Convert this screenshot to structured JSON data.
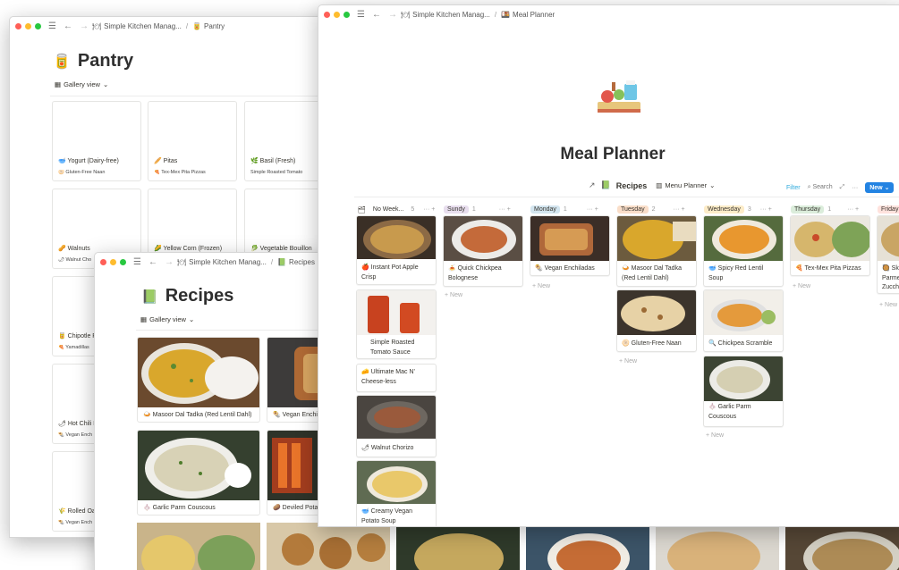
{
  "pantry_window": {
    "breadcrumb": [
      "Simple Kitchen Manag...",
      "Pantry"
    ],
    "title": "Pantry",
    "view": "Gallery view",
    "cards": [
      {
        "name": "Yogurt (Dairy-free)",
        "ref": "Gluten-Free Naan"
      },
      {
        "name": "Pitas",
        "ref": "Tex-Mex Pita Pizzas"
      },
      {
        "name": "Basil (Fresh)",
        "ref": "Simple Roasted Tomato"
      },
      {
        "name": "Walnuts",
        "ref": "Walnut Cho"
      },
      {
        "name": "Yellow Corn (Frozen)",
        "ref": ""
      },
      {
        "name": "Vegetable Bouillon",
        "ref": ""
      },
      {
        "name": "Chipotle P",
        "ref": "Yamadillas"
      },
      {
        "name": "Hot Chili P",
        "ref": "Vegan Ench"
      },
      {
        "name": "Rolled Oat",
        "ref": "Vegan Ench"
      }
    ]
  },
  "recipes_window": {
    "breadcrumb": [
      "Simple Kitchen Manag...",
      "Recipes"
    ],
    "title": "Recipes",
    "view": "Gallery view",
    "cards": [
      {
        "name": "Masoor Dal Tadka (Red Lentil Dahl)"
      },
      {
        "name": "Vegan Enchil"
      },
      {
        "name": "Garlic Parm Couscous"
      },
      {
        "name": "Deviled Potat"
      }
    ]
  },
  "meal_window": {
    "breadcrumb": [
      "Simple Kitchen Manag...",
      "Meal Planner"
    ],
    "title": "Meal Planner",
    "db_title": "Recipes",
    "view": "Menu Planner",
    "toolbar": {
      "filter": "Filter",
      "search": "Search",
      "new": "New"
    },
    "add_label": "New",
    "columns": [
      {
        "label": "No Week...",
        "count": "5",
        "color": "#ffffff",
        "cards": [
          "Instant Pot Apple Crisp",
          "Simple Roasted Tomato Sauce",
          "Ultimate Mac N' Cheese-less",
          "Walnut Chorizo",
          "Creamy Vegan Potato Soup"
        ]
      },
      {
        "label": "Sundy",
        "count": "1",
        "color": "#e8deee",
        "cards": [
          "Quick Chickpea Bolognese"
        ]
      },
      {
        "label": "Monday",
        "count": "1",
        "color": "#d3e5ef",
        "cards": [
          "Vegan Enchiladas"
        ]
      },
      {
        "label": "Tuesday",
        "count": "2",
        "color": "#fadec9",
        "cards": [
          "Masoor Dal Tadka (Red Lentil Dahl)",
          "Gluten-Free Naan"
        ]
      },
      {
        "label": "Wednesday",
        "count": "3",
        "color": "#fdecc8",
        "cards": [
          "Spicy Red Lentil Soup",
          "Chickpea Scramble",
          "Garlic Parm Couscous"
        ]
      },
      {
        "label": "Thursday",
        "count": "1",
        "color": "#dbeddb",
        "cards": [
          "Tex-Mex Pita Pizzas"
        ]
      },
      {
        "label": "Friday",
        "count": "",
        "color": "#ffe2dd",
        "cards": [
          "Ski Parme Zucch"
        ]
      }
    ],
    "colors": {
      "accent": "#2eaadc",
      "new_button": "#2383e2"
    }
  }
}
